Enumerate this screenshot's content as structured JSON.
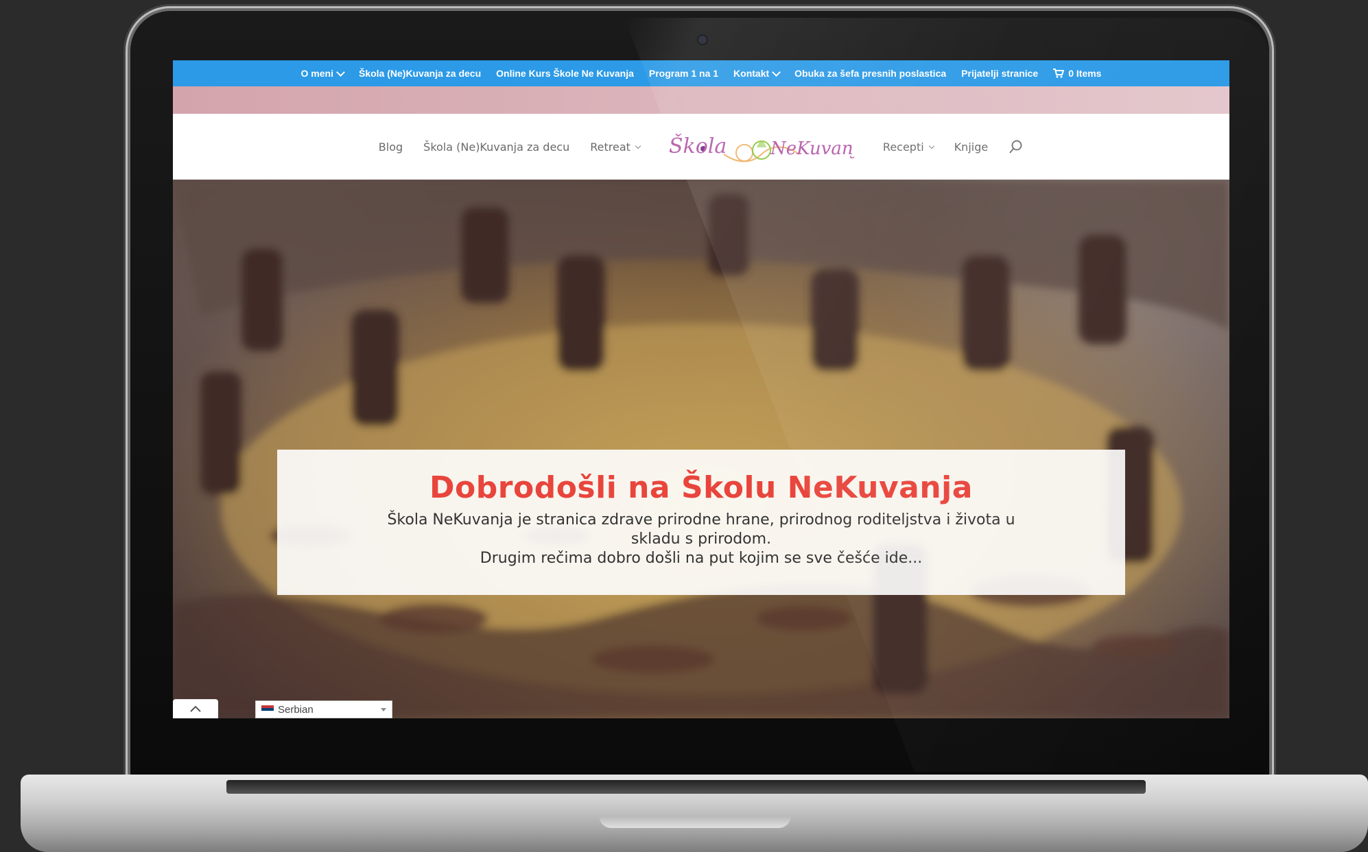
{
  "top_bar": {
    "items": [
      {
        "label": "O meni",
        "has_dropdown": true
      },
      {
        "label": "Škola (Ne)Kuvanja za decu",
        "has_dropdown": false
      },
      {
        "label": "Online Kurs Škole Ne Kuvanja",
        "has_dropdown": false
      },
      {
        "label": "Program 1 na 1",
        "has_dropdown": false
      },
      {
        "label": "Kontakt",
        "has_dropdown": true
      },
      {
        "label": "Obuka za šefa presnih poslastica",
        "has_dropdown": false
      },
      {
        "label": "Prijatelji stranice",
        "has_dropdown": false
      }
    ],
    "cart_label": "0 Items",
    "cart_icon": "cart-icon",
    "background": "#2c9ae6"
  },
  "main_nav": {
    "left": [
      {
        "label": "Blog",
        "has_dropdown": false
      },
      {
        "label": "Škola (Ne)Kuvanja za decu",
        "has_dropdown": false
      },
      {
        "label": "Retreat",
        "has_dropdown": true
      }
    ],
    "right": [
      {
        "label": "Recepti",
        "has_dropdown": true
      },
      {
        "label": "Knjige",
        "has_dropdown": false
      }
    ],
    "logo_text_left": "Škola",
    "logo_text_right": "NeKuvanja",
    "search_icon": "search-icon"
  },
  "hero": {
    "title": "Dobrodošli na Školu NeKuvanja",
    "line1": "Škola NeKuvanja je stranica zdrave prirodne hrane, prirodnog roditeljstva i života u skladu s prirodom.",
    "line2": "Drugim rečima dobro došli na put kojim se sve češće ide...",
    "title_color": "#e8453c"
  },
  "footer_widgets": {
    "language": "Serbian",
    "scroll_top_icon": "chevron-up-icon",
    "messenger_icon": "messenger-icon",
    "messenger_color": "#d87a9c"
  }
}
